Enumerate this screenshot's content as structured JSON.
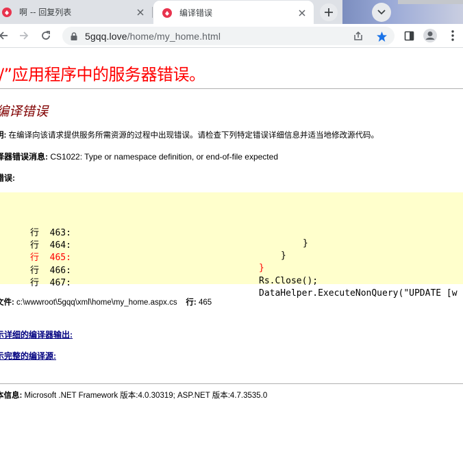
{
  "browser": {
    "tabs": [
      {
        "title": "啊 -- 回复列表",
        "active": false
      },
      {
        "title": "编译错误",
        "active": true
      }
    ],
    "url_host": "5gqq.love",
    "url_path": "/home/my_home.html",
    "accent_color": "#1a73e8",
    "favicon_color": "#e8344e"
  },
  "page": {
    "heading": "/”应用程序中的服务器错误。",
    "subheading": "编译错误",
    "description_label": "明:",
    "description_text": "在编译向该请求提供服务所需资源的过程中出现错误。请检查下列特定错误详细信息并适当地修改源代码。",
    "compiler_label": "译器错误消息:",
    "compiler_text": "CS1022: Type or namespace definition, or end-of-file expected",
    "source_error_label": "错误:",
    "code_lines": [
      {
        "label": "行  463:",
        "code": "}",
        "error": false
      },
      {
        "label": "行  464:",
        "code": "}",
        "error": false
      },
      {
        "label": "行  465:",
        "code": "}",
        "error": true
      },
      {
        "label": "行  466:",
        "code": "Rs.Close();",
        "error": false
      },
      {
        "label": "行  467:",
        "code": "DataHelper.ExecuteNonQuery(\"UPDATE [w",
        "error": false
      }
    ],
    "file_label": "文件:",
    "file_path": "c:\\wwwroot\\5gqq\\xml\\home\\my_home.aspx.cs",
    "line_label": "行:",
    "line_number": "465",
    "link_detailed_output": "示详细的编译器输出:",
    "link_complete_source": "示完整的编译源:",
    "version_label": "本信息:",
    "version_text": "Microsoft .NET Framework 版本:4.0.30319; ASP.NET 版本:4.7.3535.0"
  }
}
